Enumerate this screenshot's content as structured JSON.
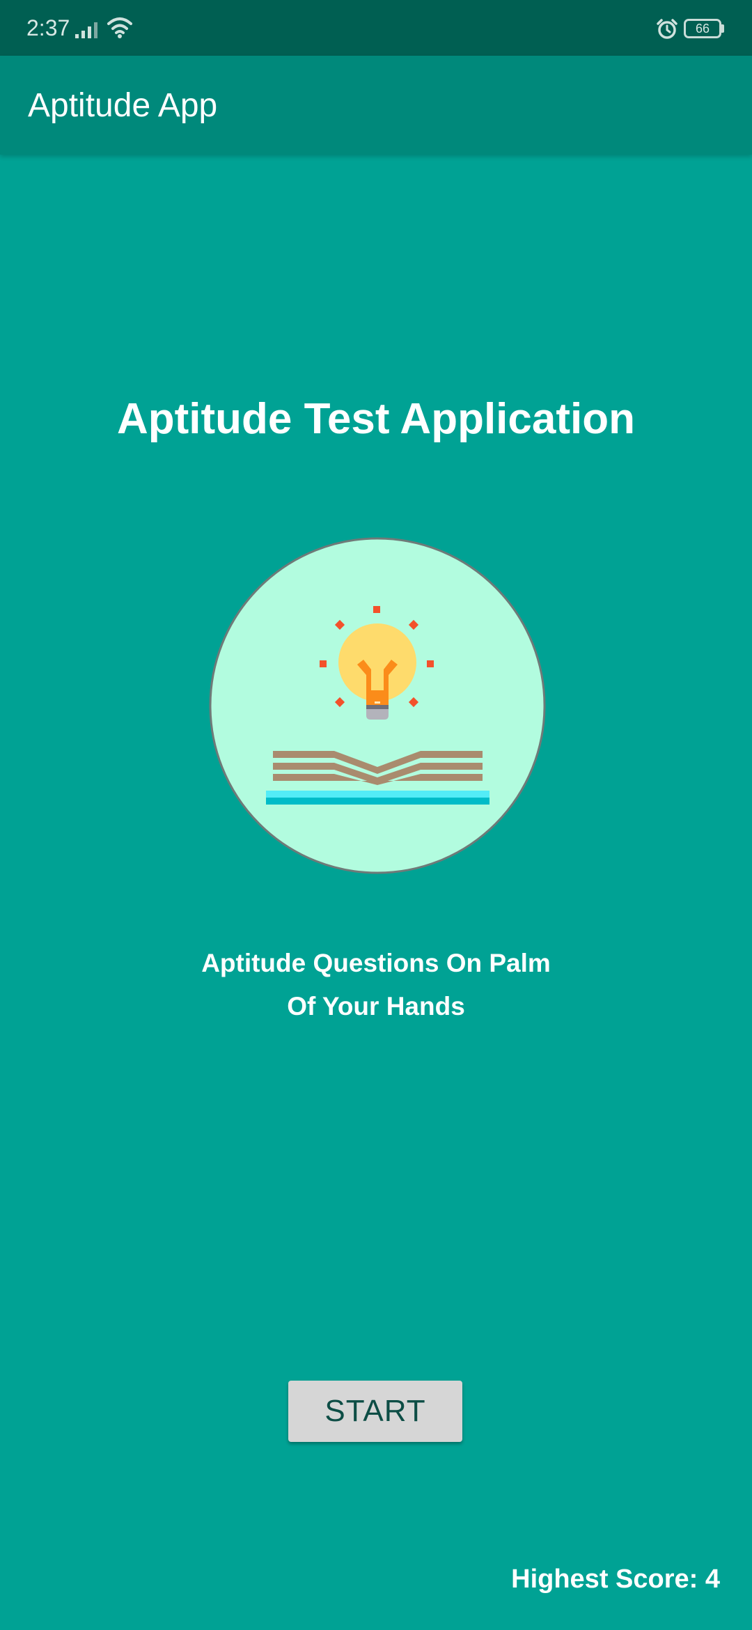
{
  "status_bar": {
    "time": "2:37",
    "battery": "66",
    "icons": [
      "signal-icon",
      "wifi-icon",
      "alarm-icon",
      "battery-icon"
    ]
  },
  "app_bar": {
    "title": "Aptitude App"
  },
  "main": {
    "title": "Aptitude Test Application",
    "logo": "lightbulb-book-icon",
    "tagline_line1": "Aptitude Questions On Palm",
    "tagline_line2": "Of Your Hands",
    "start_label": "START",
    "highest_score": "Highest Score: 4"
  },
  "colors": {
    "background": "#00a294",
    "status_bar": "#005f52",
    "app_bar": "#00897b",
    "logo_circle": "#b2fcdf",
    "button": "#d6d6d6",
    "button_text": "#0d4d45"
  }
}
